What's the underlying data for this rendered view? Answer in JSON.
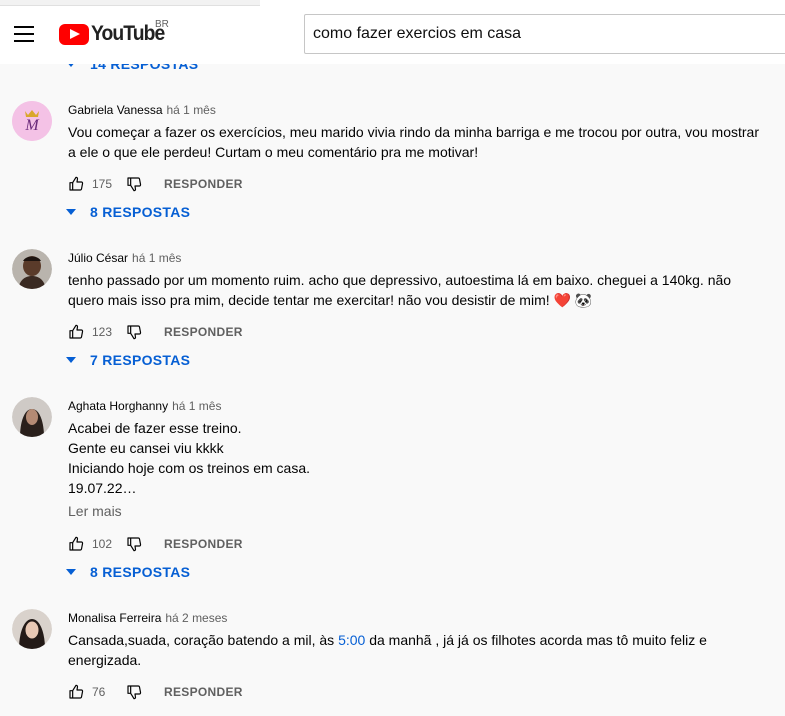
{
  "header": {
    "logo_text": "YouTube",
    "region": "BR",
    "search_value": "como fazer exercios em casa"
  },
  "top_replies": {
    "label": "14 RESPOSTAS"
  },
  "comments": [
    {
      "author": "Gabriela Vanessa",
      "date": "há 1 mês",
      "text_lines": [
        "Vou começar a fazer os exercícios, meu marido vivia rindo da minha barriga e me trocou por outra, vou mostrar",
        "a ele o que ele perdeu! Curtam o meu comentário pra me motivar!"
      ],
      "likes": "175",
      "reply_label": "RESPONDER",
      "replies_label": "8 RESPOSTAS"
    },
    {
      "author": "Júlio César",
      "date": "há 1 mês",
      "text_lines": [
        "tenho passado por um momento ruim. acho que depressivo, autoestima lá em baixo. cheguei a 140kg. não",
        "quero mais isso pra mim, decide tentar me exercitar! não vou desistir de mim! ❤️ 🐼"
      ],
      "likes": "123",
      "reply_label": "RESPONDER",
      "replies_label": "7 RESPOSTAS"
    },
    {
      "author": "Aghata Horghanny",
      "date": "há 1 mês",
      "text_lines": [
        "Acabei de fazer esse treino.",
        "Gente eu cansei viu kkkk",
        "Iniciando hoje com os treinos em casa.",
        "19.07.22…"
      ],
      "read_more": "Ler mais",
      "likes": "102",
      "reply_label": "RESPONDER",
      "replies_label": "8 RESPOSTAS"
    },
    {
      "author": "Monalisa Ferreira",
      "date": "há 2 meses",
      "text_before_timestamp": "Cansada,suada, coração batendo a mil, às ",
      "timestamp": "5:00",
      "text_after_timestamp": " da manhã , já já os filhotes acorda mas tô muito feliz e",
      "text_line2": "energizada.",
      "likes": "76",
      "reply_label": "RESPONDER"
    }
  ],
  "colors": {
    "link_blue": "#065fd4",
    "youtube_red": "#ff0000",
    "meta_gray": "#606060"
  },
  "icons": [
    "menu-icon",
    "thumbs-up-icon",
    "thumbs-down-icon",
    "caret-down-icon",
    "heart-emoji",
    "panda-emoji"
  ]
}
